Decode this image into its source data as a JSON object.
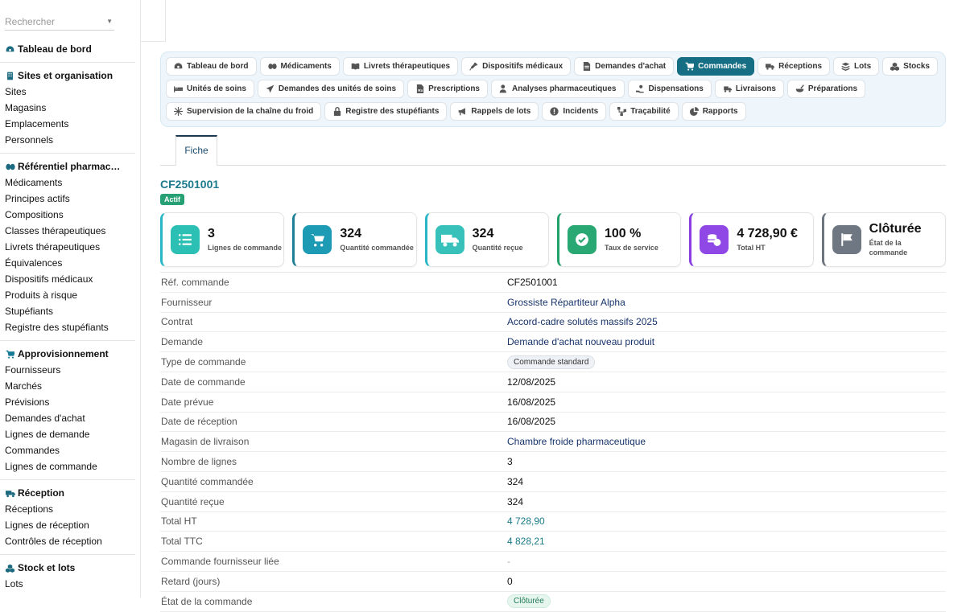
{
  "sidebar": {
    "search_placeholder": "Rechercher",
    "sections": [
      {
        "title": "Tableau de bord",
        "icon": "dashboard-icon",
        "items": []
      },
      {
        "title": "Sites et organisation",
        "icon": "building-icon",
        "items": [
          "Sites",
          "Magasins",
          "Emplacements",
          "Personnels"
        ]
      },
      {
        "title": "Référentiel pharmac…",
        "icon": "pills-icon",
        "items": [
          "Médicaments",
          "Principes actifs",
          "Compositions",
          "Classes thérapeutiques",
          "Livrets thérapeutiques",
          "Équivalences",
          "Dispositifs médicaux",
          "Produits à risque",
          "Stupéfiants",
          "Registre des stupéfiants"
        ]
      },
      {
        "title": "Approvisionnement",
        "icon": "cart-icon",
        "items": [
          "Fournisseurs",
          "Marchés",
          "Prévisions",
          "Demandes d'achat",
          "Lignes de demande",
          "Commandes",
          "Lignes de commande"
        ]
      },
      {
        "title": "Réception",
        "icon": "truck-icon",
        "items": [
          "Réceptions",
          "Lignes de réception",
          "Contrôles de réception"
        ]
      },
      {
        "title": "Stock et lots",
        "icon": "cubes-icon",
        "items": [
          "Lots"
        ]
      }
    ]
  },
  "nav": {
    "rows": [
      [
        {
          "label": "Tableau de bord",
          "icon": "dashboard-icon",
          "active": false
        },
        {
          "label": "Médicaments",
          "icon": "pills-icon",
          "active": false
        },
        {
          "label": "Livrets thérapeutiques",
          "icon": "book-icon",
          "active": false
        },
        {
          "label": "Dispositifs médicaux",
          "icon": "syringe-icon",
          "active": false
        },
        {
          "label": "Demandes d'achat",
          "icon": "file-icon",
          "active": false
        },
        {
          "label": "Commandes",
          "icon": "cart-icon",
          "active": true
        },
        {
          "label": "Réceptions",
          "icon": "truck-icon",
          "active": false
        },
        {
          "label": "Lots",
          "icon": "layers-icon",
          "active": false
        },
        {
          "label": "Stocks",
          "icon": "cubes-icon",
          "active": false
        }
      ],
      [
        {
          "label": "Unités de soins",
          "icon": "bed-icon",
          "active": false
        },
        {
          "label": "Demandes des unités de soins",
          "icon": "send-icon",
          "active": false
        },
        {
          "label": "Prescriptions",
          "icon": "prescription-icon",
          "active": false
        },
        {
          "label": "Analyses pharmaceutiques",
          "icon": "user-doctor-icon",
          "active": false
        },
        {
          "label": "Dispensations",
          "icon": "hand-icon",
          "active": false
        },
        {
          "label": "Livraisons",
          "icon": "truck-fast-icon",
          "active": false
        },
        {
          "label": "Préparations",
          "icon": "mortar-icon",
          "active": false
        }
      ],
      [
        {
          "label": "Supervision de la chaîne du froid",
          "icon": "snowflake-icon",
          "active": false
        },
        {
          "label": "Registre des stupéfiants",
          "icon": "lock-icon",
          "active": false
        },
        {
          "label": "Rappels de lots",
          "icon": "megaphone-icon",
          "active": false
        },
        {
          "label": "Incidents",
          "icon": "alert-icon",
          "active": false
        },
        {
          "label": "Traçabilité",
          "icon": "network-icon",
          "active": false
        },
        {
          "label": "Rapports",
          "icon": "chart-pie-icon",
          "active": false
        }
      ]
    ]
  },
  "tab": {
    "label": "Fiche"
  },
  "record": {
    "title": "CF2501001",
    "status_badge": "Actif",
    "cards": [
      {
        "value": "3",
        "label": "Lignes de commande",
        "icon": "list-icon",
        "accent": "#2ab7c5",
        "icon_bg": "#2bc0b3"
      },
      {
        "value": "324",
        "label": "Quantité commandée",
        "icon": "cart-icon",
        "accent": "#1e7f96",
        "icon_bg": "#1d9bb5"
      },
      {
        "value": "324",
        "label": "Quantité reçue",
        "icon": "truck-icon",
        "accent": "#2ab7c5",
        "icon_bg": "#38c1bb"
      },
      {
        "value": "100 %",
        "label": "Taux de service",
        "icon": "check-circle-icon",
        "accent": "#22a06b",
        "icon_bg": "#2aa873"
      },
      {
        "value": "4 728,90 €",
        "label": "Total HT",
        "icon": "coins-icon",
        "accent": "#8a3ee0",
        "icon_bg": "#8f47e6"
      },
      {
        "value": "Clôturée",
        "label": "État de la commande",
        "icon": "flag-icon",
        "accent": "#6c757d",
        "icon_bg": "#6f7783"
      }
    ],
    "fields": [
      {
        "key": "Réf. commande",
        "value": "CF2501001",
        "style": "plain"
      },
      {
        "key": "Fournisseur",
        "value": "Grossiste Répartiteur Alpha",
        "style": "link"
      },
      {
        "key": "Contrat",
        "value": "Accord-cadre solutés massifs 2025",
        "style": "link"
      },
      {
        "key": "Demande",
        "value": "Demande d'achat nouveau produit",
        "style": "link"
      },
      {
        "key": "Type de commande",
        "value": "Commande standard",
        "style": "chip"
      },
      {
        "key": "Date de commande",
        "value": "12/08/2025",
        "style": "plain"
      },
      {
        "key": "Date prévue",
        "value": "16/08/2025",
        "style": "plain"
      },
      {
        "key": "Date de réception",
        "value": "16/08/2025",
        "style": "plain"
      },
      {
        "key": "Magasin de livraison",
        "value": "Chambre froide pharmaceutique",
        "style": "link"
      },
      {
        "key": "Nombre de lignes",
        "value": "3",
        "style": "plain"
      },
      {
        "key": "Quantité commandée",
        "value": "324",
        "style": "plain"
      },
      {
        "key": "Quantité reçue",
        "value": "324",
        "style": "plain"
      },
      {
        "key": "Total HT",
        "value": "4 728,90",
        "style": "teal"
      },
      {
        "key": "Total TTC",
        "value": "4 828,21",
        "style": "teal"
      },
      {
        "key": "Commande fournisseur liée",
        "value": "-",
        "style": "muted"
      },
      {
        "key": "Retard (jours)",
        "value": "0",
        "style": "plain"
      },
      {
        "key": "État de la commande",
        "value": "Clôturée",
        "style": "chip-green"
      }
    ]
  }
}
